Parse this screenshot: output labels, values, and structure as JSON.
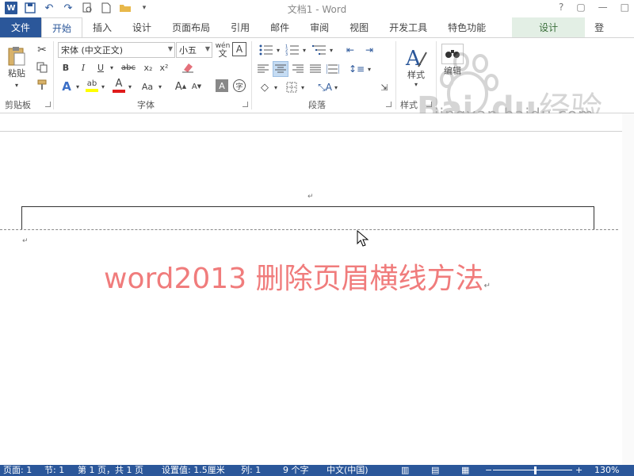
{
  "title_bar": {
    "doc_title": "文档1 - Word",
    "help": "?",
    "window_controls": [
      "ribbon-display-icon",
      "minimize-icon",
      "restore-icon",
      "close-icon"
    ]
  },
  "tabs": [
    {
      "label": "文件",
      "kind": "file"
    },
    {
      "label": "开始",
      "kind": "active"
    },
    {
      "label": "插入"
    },
    {
      "label": "设计"
    },
    {
      "label": "页面布局"
    },
    {
      "label": "引用"
    },
    {
      "label": "邮件"
    },
    {
      "label": "审阅"
    },
    {
      "label": "视图"
    },
    {
      "label": "开发工具"
    },
    {
      "label": "特色功能"
    },
    {
      "label": "设计",
      "kind": "context"
    },
    {
      "label": "登",
      "kind": "login"
    }
  ],
  "ribbon": {
    "clipboard": {
      "paste_label": "粘贴",
      "group_label": "剪贴板"
    },
    "font": {
      "font_name": "宋体 (中文正文)",
      "font_size": "小五",
      "wen_label": "wén",
      "bold": "B",
      "italic": "I",
      "underline": "U",
      "strike": "abc",
      "subscript": "x₂",
      "superscript": "x²",
      "grow": "A",
      "shrink": "A",
      "change_case": "Aa",
      "char_border": "A",
      "group_label": "字体"
    },
    "paragraph": {
      "group_label": "段落"
    },
    "styles": {
      "label": "样式",
      "group_label": "样式"
    },
    "editing": {
      "label": "编辑"
    }
  },
  "document": {
    "paragraph_mark": "↵",
    "heading": "word2013 删除页眉横线方法"
  },
  "watermark": {
    "brand": "Baidu 经验",
    "url": "jingyan.baidu.com"
  },
  "status_bar": {
    "page": "页面: 1",
    "section": "节: 1",
    "page_of": "第 1 页，共 1 页",
    "setting": "设置值: 1.5厘米",
    "column": "列: 1",
    "words": "9 个字",
    "language": "中文(中国)",
    "zoom": "130%"
  },
  "colors": {
    "accent": "#2b579a",
    "heading": "#f07c7c",
    "context_tab": "#e3efe5"
  }
}
